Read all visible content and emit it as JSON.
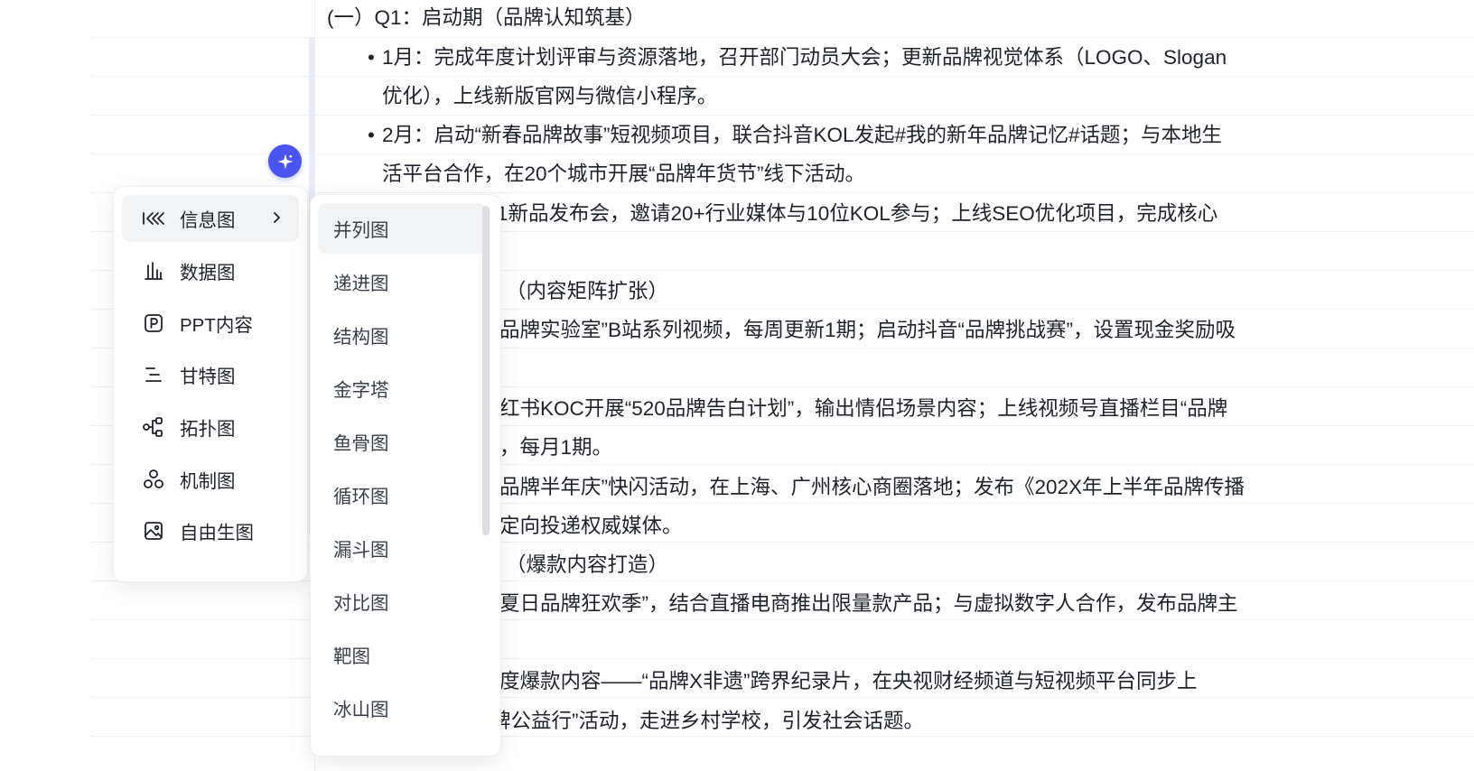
{
  "document": {
    "lines": [
      "(一）Q1：启动期（品牌认知筑基）",
      "1月：完成年度计划评审与资源落地，召开部门动员大会；更新品牌视觉体系（LOGO、Slogan",
      "优化），上线新版官网与微信小程序。",
      "2月：启动“新春品牌故事”短视频项目，联合抖音KOL发起#我的新年品牌记忆#话题；与本地生",
      "活平台合作，在20个城市开展“品牌年货节”线下活动。",
      "1新品发布会，邀请20+行业媒体与10位KOL参与；上线SEO优化项目，完成核心",
      "（内容矩阵扩张）",
      "品牌实验室”B站系列视频，每周更新1期；启动抖音“品牌挑战赛”，设置现金奖励吸",
      "红书KOC开展“520品牌告白计划”，输出情侣场景内容；上线视频号直播栏目“品牌",
      "，每月1期。",
      "品牌半年庆”快闪活动，在上海、广州核心商圈落地；发布《202X年上半年品牌传播",
      "定向投递权威媒体。",
      "（爆款内容打造）",
      "夏日品牌狂欢季”，结合直播电商推出限量款产品；与虚拟数字人合作，发布品牌主",
      "度爆款内容——“品牌X非遗”跨界纪录片，在央视财经频道与短视频平台同步上",
      "线，开展“品牌公益行”活动，走进乡村学校，引发社会话题。"
    ]
  },
  "ai_button": {
    "icon": "sparkle-icon",
    "color": "#4a54f1"
  },
  "main_menu": {
    "items": [
      {
        "label": "信息图",
        "icon": "infographic-icon",
        "active": true,
        "has_submenu": true
      },
      {
        "label": "数据图",
        "icon": "bar-chart-icon"
      },
      {
        "label": "PPT内容",
        "icon": "ppt-icon"
      },
      {
        "label": "甘特图",
        "icon": "gantt-icon"
      },
      {
        "label": "拓扑图",
        "icon": "topology-icon"
      },
      {
        "label": "机制图",
        "icon": "mechanism-icon"
      },
      {
        "label": "自由生图",
        "icon": "image-icon"
      }
    ]
  },
  "sub_menu": {
    "items": [
      {
        "label": "并列图",
        "active": true
      },
      {
        "label": "递进图"
      },
      {
        "label": "结构图"
      },
      {
        "label": "金字塔"
      },
      {
        "label": "鱼骨图"
      },
      {
        "label": "循环图"
      },
      {
        "label": "漏斗图"
      },
      {
        "label": "对比图"
      },
      {
        "label": "靶图"
      },
      {
        "label": "冰山图"
      }
    ]
  }
}
